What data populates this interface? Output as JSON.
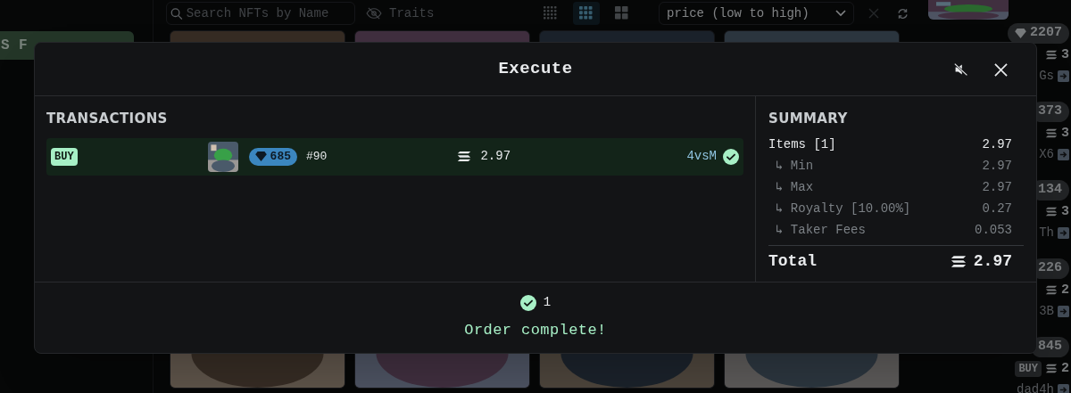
{
  "page": {
    "search": {
      "placeholder": "Search NFTs by Name"
    },
    "traits_button": "Traits",
    "view_options": [
      {
        "kind": "dense",
        "selected": false
      },
      {
        "kind": "medium",
        "selected": true
      },
      {
        "kind": "large",
        "selected": false
      }
    ],
    "sort": {
      "value": "price (low to high)"
    },
    "sidebar_tab": "S F",
    "side_listings": [
      {
        "rank": "2207",
        "price": "3",
        "name": "Gs"
      },
      {
        "rank": "373",
        "price": "3",
        "name": "X6"
      },
      {
        "rank": "134",
        "price": "3",
        "name": "Th"
      },
      {
        "rank": "226",
        "price": "2",
        "name": "3B"
      },
      {
        "rank": "845",
        "buy": "BUY",
        "price": "2",
        "name": "dad4h"
      }
    ]
  },
  "modal": {
    "title": "Execute",
    "muted": true,
    "transactions": {
      "heading": "TRANSACTIONS",
      "rows": [
        {
          "side": "BUY",
          "rank": "685",
          "token": "#90",
          "price": "2.97",
          "wallet": "4vsM",
          "complete": true
        }
      ]
    },
    "summary": {
      "heading": "SUMMARY",
      "rows": [
        {
          "kind": "main",
          "label": "Items [1]",
          "value": "2.97"
        },
        {
          "kind": "sub",
          "prefix": "↳",
          "label": "Min",
          "value": "2.97"
        },
        {
          "kind": "sub",
          "prefix": "↳",
          "label": "Max",
          "value": "2.97"
        },
        {
          "kind": "sub",
          "prefix": "↳",
          "label": "Royalty [10.00%]",
          "value": "0.27"
        },
        {
          "kind": "sub",
          "prefix": "↳",
          "label": "Taker Fees",
          "value": "0.053"
        }
      ],
      "total_label": "Total",
      "total_value": "2.97"
    },
    "footer": {
      "count": "1",
      "message": "Order complete!"
    }
  }
}
